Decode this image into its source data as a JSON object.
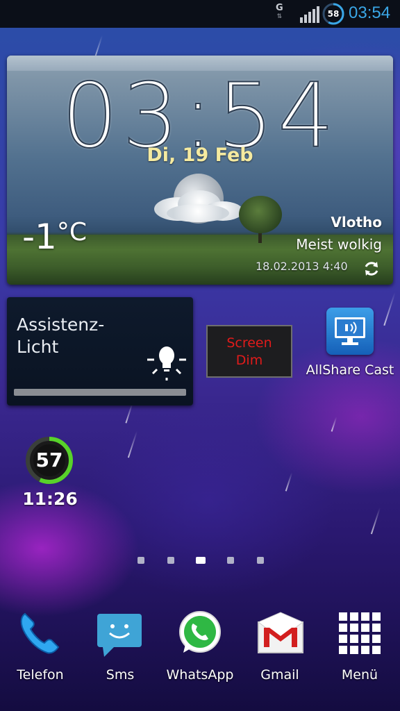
{
  "status_bar": {
    "network_type": "G",
    "network_arrows": "⇅",
    "battery_level": "58",
    "time": "03:54",
    "clock_color": "#3aa6e6"
  },
  "weather_widget": {
    "time": "03:54",
    "date": "Di, 19 Feb",
    "temperature": "-1",
    "unit": "°C",
    "city": "Vlotho",
    "condition": "Meist wolkig",
    "updated": "18.02.2013 4:40",
    "date_color": "#f5eaa0",
    "icons": [
      "moon-cloud-icon",
      "refresh-icon"
    ]
  },
  "assist_light": {
    "title": "Assistenz-Licht",
    "icon": "light-bulb-icon"
  },
  "screen_dim": {
    "line1": "Screen",
    "line2": "Dim",
    "text_color": "#e11b1b"
  },
  "allshare": {
    "label": "AllShare Cast",
    "icon": "monitor-cast-icon"
  },
  "battery_widget": {
    "level": "57",
    "level_fraction": 0.57,
    "time": "11:26",
    "ring_color": "#58d22a"
  },
  "pages": {
    "count": 5,
    "active_index": 2
  },
  "dock": [
    {
      "label": "Telefon",
      "icon": "phone-icon"
    },
    {
      "label": "Sms",
      "icon": "sms-icon"
    },
    {
      "label": "WhatsApp",
      "icon": "whatsapp-icon"
    },
    {
      "label": "Gmail",
      "icon": "gmail-icon"
    },
    {
      "label": "Menü",
      "icon": "app-grid-icon"
    }
  ]
}
